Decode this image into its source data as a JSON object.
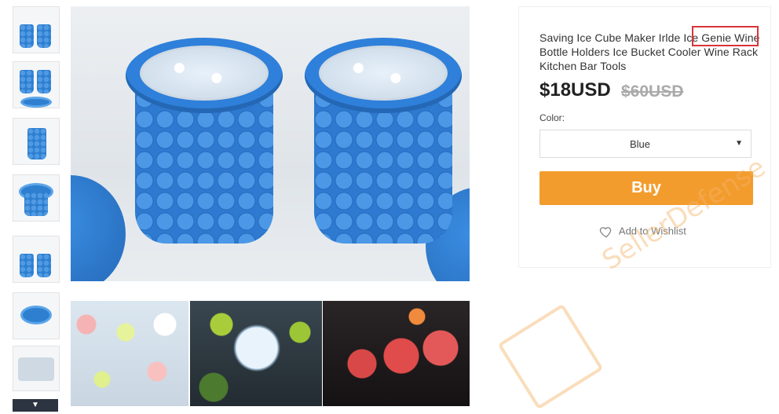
{
  "product": {
    "title_main": "Saving Ice Cube Maker Irlde",
    "title_highlight": "Ice Genie",
    "title_rest": "Wine Bottle Holders Ice Bucket Cooler Wine Rack Kitchen Bar Tools",
    "price": "$18USD",
    "old_price": "$60USD",
    "color_label": "Color:",
    "color_value": "Blue",
    "buy_label": "Buy",
    "wishlist_label": "Add to Wishlist"
  },
  "watermark": {
    "text": "SellerDefense"
  },
  "icons": {
    "heart": "heart-icon",
    "caret": "chevron-down-icon",
    "thumb_scroll": "chevron-down-icon"
  },
  "colors": {
    "buy": "#f39c2e",
    "highlight_box": "#d9343a",
    "product_blue": "#2e7ad0"
  }
}
